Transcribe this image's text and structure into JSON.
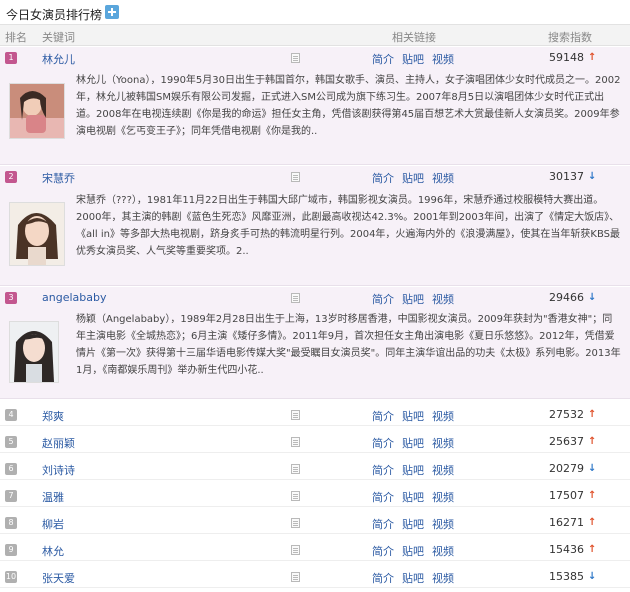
{
  "page": {
    "title": "今日女演员排行榜",
    "add_icon": "plus-icon"
  },
  "header": {
    "rank": "排名",
    "keyword": "关键词",
    "links": "相关链接",
    "index": "搜索指数"
  },
  "links": {
    "intro": "简介",
    "tieba": "贴吧",
    "video": "视频"
  },
  "colors": {
    "top_rank_badge": "#c3578f",
    "plain_rank_badge": "#b0b0b0",
    "link_blue": "#2b5aa3",
    "trend_up": "#e0522c",
    "trend_down": "#2f78c8",
    "expanded_bg": "#f7f1f8"
  },
  "rows": [
    {
      "rank": "1",
      "name": "林允儿",
      "index": "59148",
      "trend": "up",
      "trend_glyph": "↑",
      "description": "林允儿（Yoona），1990年5月30日出生于韩国首尔，韩国女歌手、演员、主持人，女子演唱团体少女时代成员之一。2002年，林允儿被韩国SM娱乐有限公司发掘，正式进入SM公司成为旗下练习生。2007年8月5日以演唱团体少女时代正式出道。2008年在电视连续剧《你是我的命运》担任女主角，凭借该剧获得第45届百想艺术大赏最佳新人女演员奖。2009年参演电视剧《乞丐变王子》；同年凭借电视剧《你是我的.."
    },
    {
      "rank": "2",
      "name": "宋慧乔",
      "index": "30137",
      "trend": "down",
      "trend_glyph": "↓",
      "description": "宋慧乔（???），1981年11月22日出生于韩国大邱广域市，韩国影视女演员。1996年，宋慧乔通过校服模特大赛出道。2000年，其主演的韩剧《蓝色生死恋》风靡亚洲，此剧最高收视达42.3%。2001年到2003年间，出演了《情定大饭店》、《all in》等多部大热电视剧，跻身炙手可热的韩流明星行列。2004年，火遍海内外的《浪漫满屋》，使其在当年斩获KBS最优秀女演员奖、人气奖等重要奖项。2.."
    },
    {
      "rank": "3",
      "name": "angelababy",
      "index": "29466",
      "trend": "down",
      "trend_glyph": "↓",
      "description": "杨颖（Angelababy），1989年2月28日出生于上海，13岁时移居香港，中国影视女演员。2009年获封为\"香港女神\"；同年主演电影《全城热恋》；6月主演《矮仔多情》。2011年9月，首次担任女主角出演电影《夏日乐悠悠》。2012年，凭借爱情片《第一次》获得第十三届华语电影传媒大奖\"最受瞩目女演员奖\"。同年主演华谊出品的功夫《太极》系列电影。2013年1月，《南都娱乐周刊》举办新生代四小花.."
    },
    {
      "rank": "4",
      "name": "郑爽",
      "index": "27532",
      "trend": "up",
      "trend_glyph": "↑"
    },
    {
      "rank": "5",
      "name": "赵丽颖",
      "index": "25637",
      "trend": "up",
      "trend_glyph": "↑"
    },
    {
      "rank": "6",
      "name": "刘诗诗",
      "index": "20279",
      "trend": "down",
      "trend_glyph": "↓"
    },
    {
      "rank": "7",
      "name": "温雅",
      "index": "17507",
      "trend": "up",
      "trend_glyph": "↑"
    },
    {
      "rank": "8",
      "name": "柳岩",
      "index": "16271",
      "trend": "up",
      "trend_glyph": "↑"
    },
    {
      "rank": "9",
      "name": "林允",
      "index": "15436",
      "trend": "up",
      "trend_glyph": "↑"
    },
    {
      "rank": "10",
      "name": "张天爱",
      "index": "15385",
      "trend": "down",
      "trend_glyph": "↓"
    }
  ]
}
